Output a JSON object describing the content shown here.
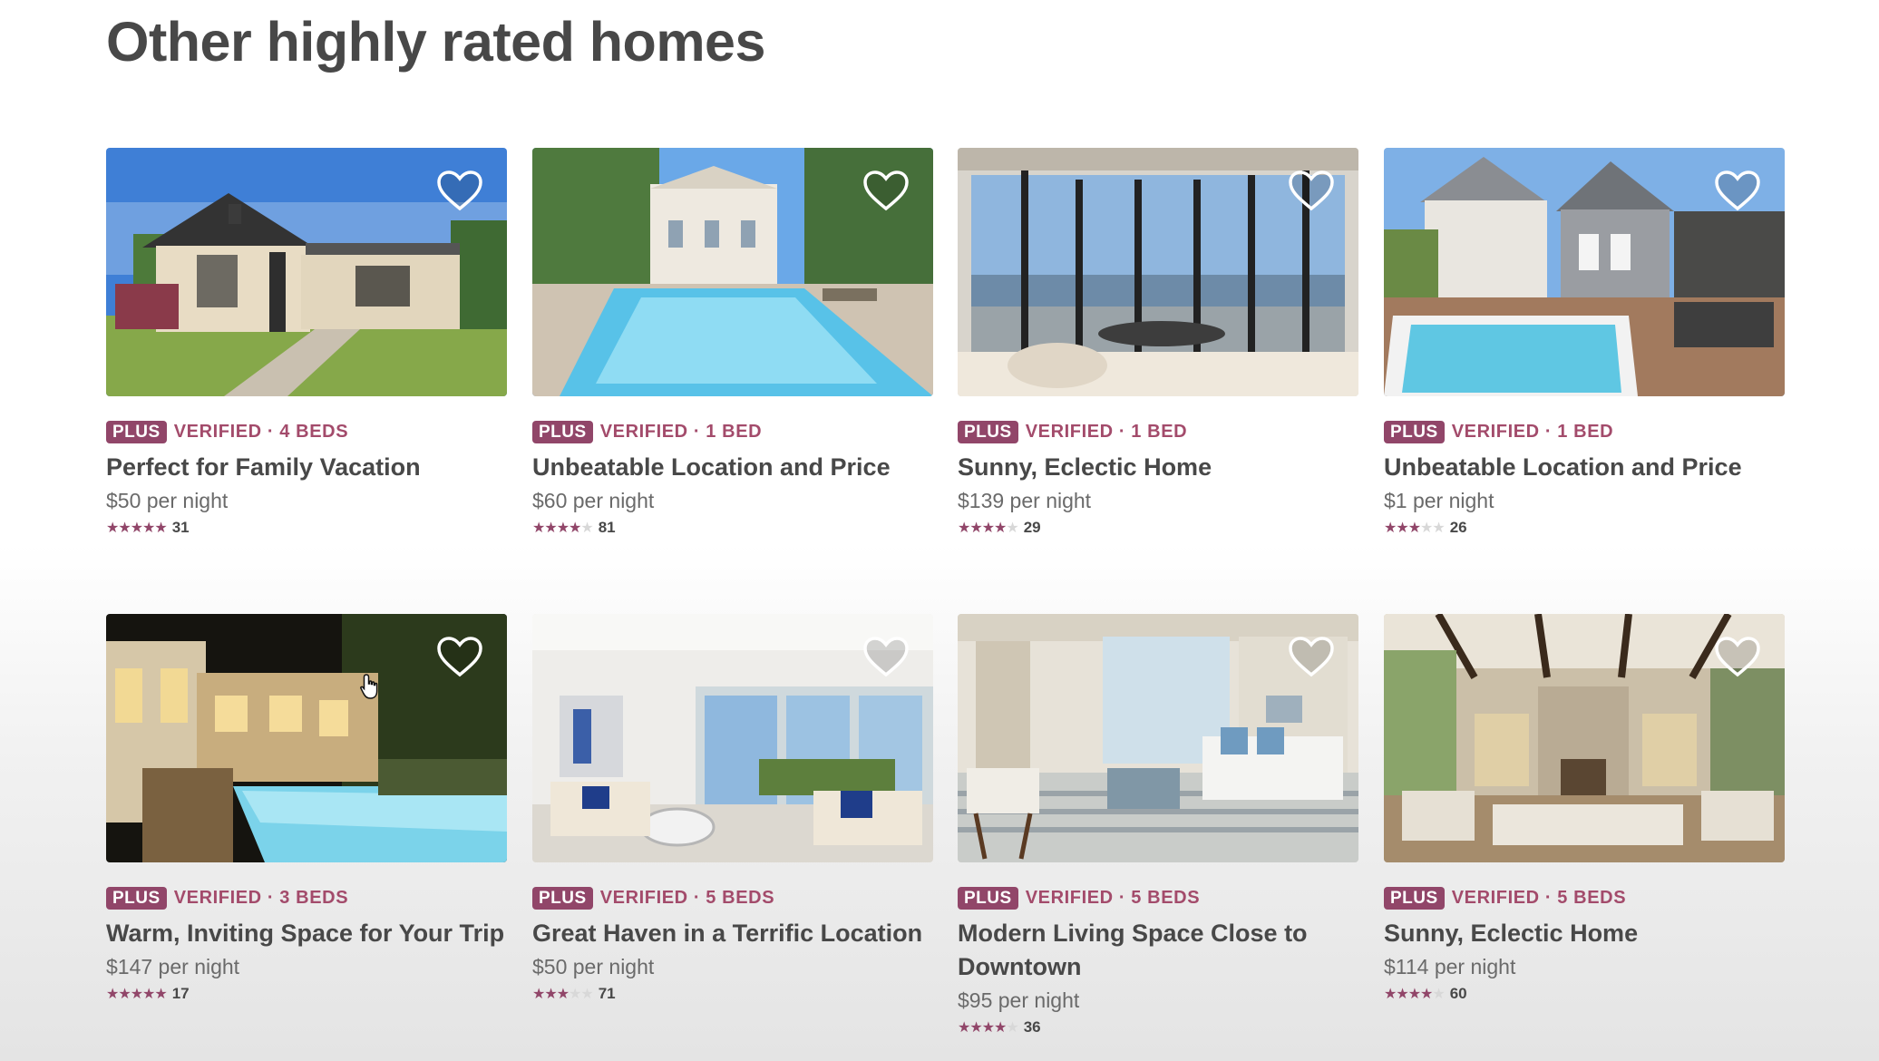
{
  "page": {
    "title": "Other highly rated homes"
  },
  "colors": {
    "accent": "#914669",
    "text": "#484848",
    "muted": "#6a6a6a",
    "verified": "#a34b6b"
  },
  "listings": [
    {
      "badge": "PLUS",
      "meta": "VERIFIED · 4 BEDS",
      "title": "Perfect for Family Vacation",
      "price": "$50 per night",
      "rating": 5,
      "reviews": "31",
      "scene": "house"
    },
    {
      "badge": "PLUS",
      "meta": "VERIFIED · 1 BED",
      "title": "Unbeatable Location and Price",
      "price": "$60 per night",
      "rating": 4,
      "reviews": "81",
      "scene": "pool"
    },
    {
      "badge": "PLUS",
      "meta": "VERIFIED · 1 BED",
      "title": "Sunny, Eclectic Home",
      "price": "$139 per night",
      "rating": 4,
      "reviews": "29",
      "scene": "view"
    },
    {
      "badge": "PLUS",
      "meta": "VERIFIED · 1 BED",
      "title": "Unbeatable Location and Price",
      "price": "$1 per night",
      "rating": 3,
      "reviews": "26",
      "scene": "modern-pool"
    },
    {
      "badge": "PLUS",
      "meta": "VERIFIED · 3 BEDS",
      "title": "Warm, Inviting Space for Your Trip",
      "price": "$147 per night",
      "rating": 5,
      "reviews": "17",
      "scene": "night-pool"
    },
    {
      "badge": "PLUS",
      "meta": "VERIFIED · 5 BEDS",
      "title": "Great Haven in a Terrific Location",
      "price": "$50 per night",
      "rating": 3,
      "reviews": "71",
      "scene": "living-white"
    },
    {
      "badge": "PLUS",
      "meta": "VERIFIED · 5 BEDS",
      "title": "Modern Living Space Close to Downtown",
      "price": "$95 per night",
      "rating": 4,
      "reviews": "36",
      "scene": "living-blue"
    },
    {
      "badge": "PLUS",
      "meta": "VERIFIED · 5 BEDS",
      "title": "Sunny, Eclectic Home",
      "price": "$114 per night",
      "rating": 4,
      "reviews": "60",
      "scene": "great-room"
    }
  ],
  "icons": {
    "favorite": "heart-outline-icon",
    "star": "star-icon",
    "cursor": "hand-cursor-icon"
  }
}
